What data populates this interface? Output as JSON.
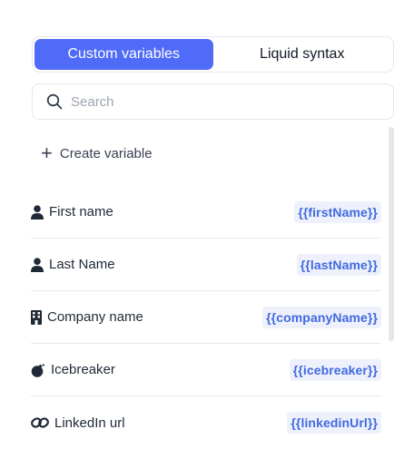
{
  "tabs": [
    {
      "label": "Custom variables",
      "active": true
    },
    {
      "label": "Liquid syntax",
      "active": false
    }
  ],
  "search": {
    "placeholder": "Search",
    "value": "",
    "icon": "search-icon"
  },
  "create": {
    "label": "Create variable",
    "icon": "plus-icon"
  },
  "variables": [
    {
      "label": "First name",
      "token": "{{firstName}}",
      "icon": "person-icon"
    },
    {
      "label": "Last Name",
      "token": "{{lastName}}",
      "icon": "person-icon"
    },
    {
      "label": "Company name",
      "token": "{{companyName}}",
      "icon": "building-icon"
    },
    {
      "label": "Icebreaker",
      "token": "{{icebreaker}}",
      "icon": "bomb-icon"
    },
    {
      "label": "LinkedIn url",
      "token": "{{linkedinUrl}}",
      "icon": "link-icon"
    }
  ],
  "colors": {
    "accent": "#4f6bf7",
    "chip_bg": "#eef1fb",
    "chip_text": "#4169e1"
  }
}
